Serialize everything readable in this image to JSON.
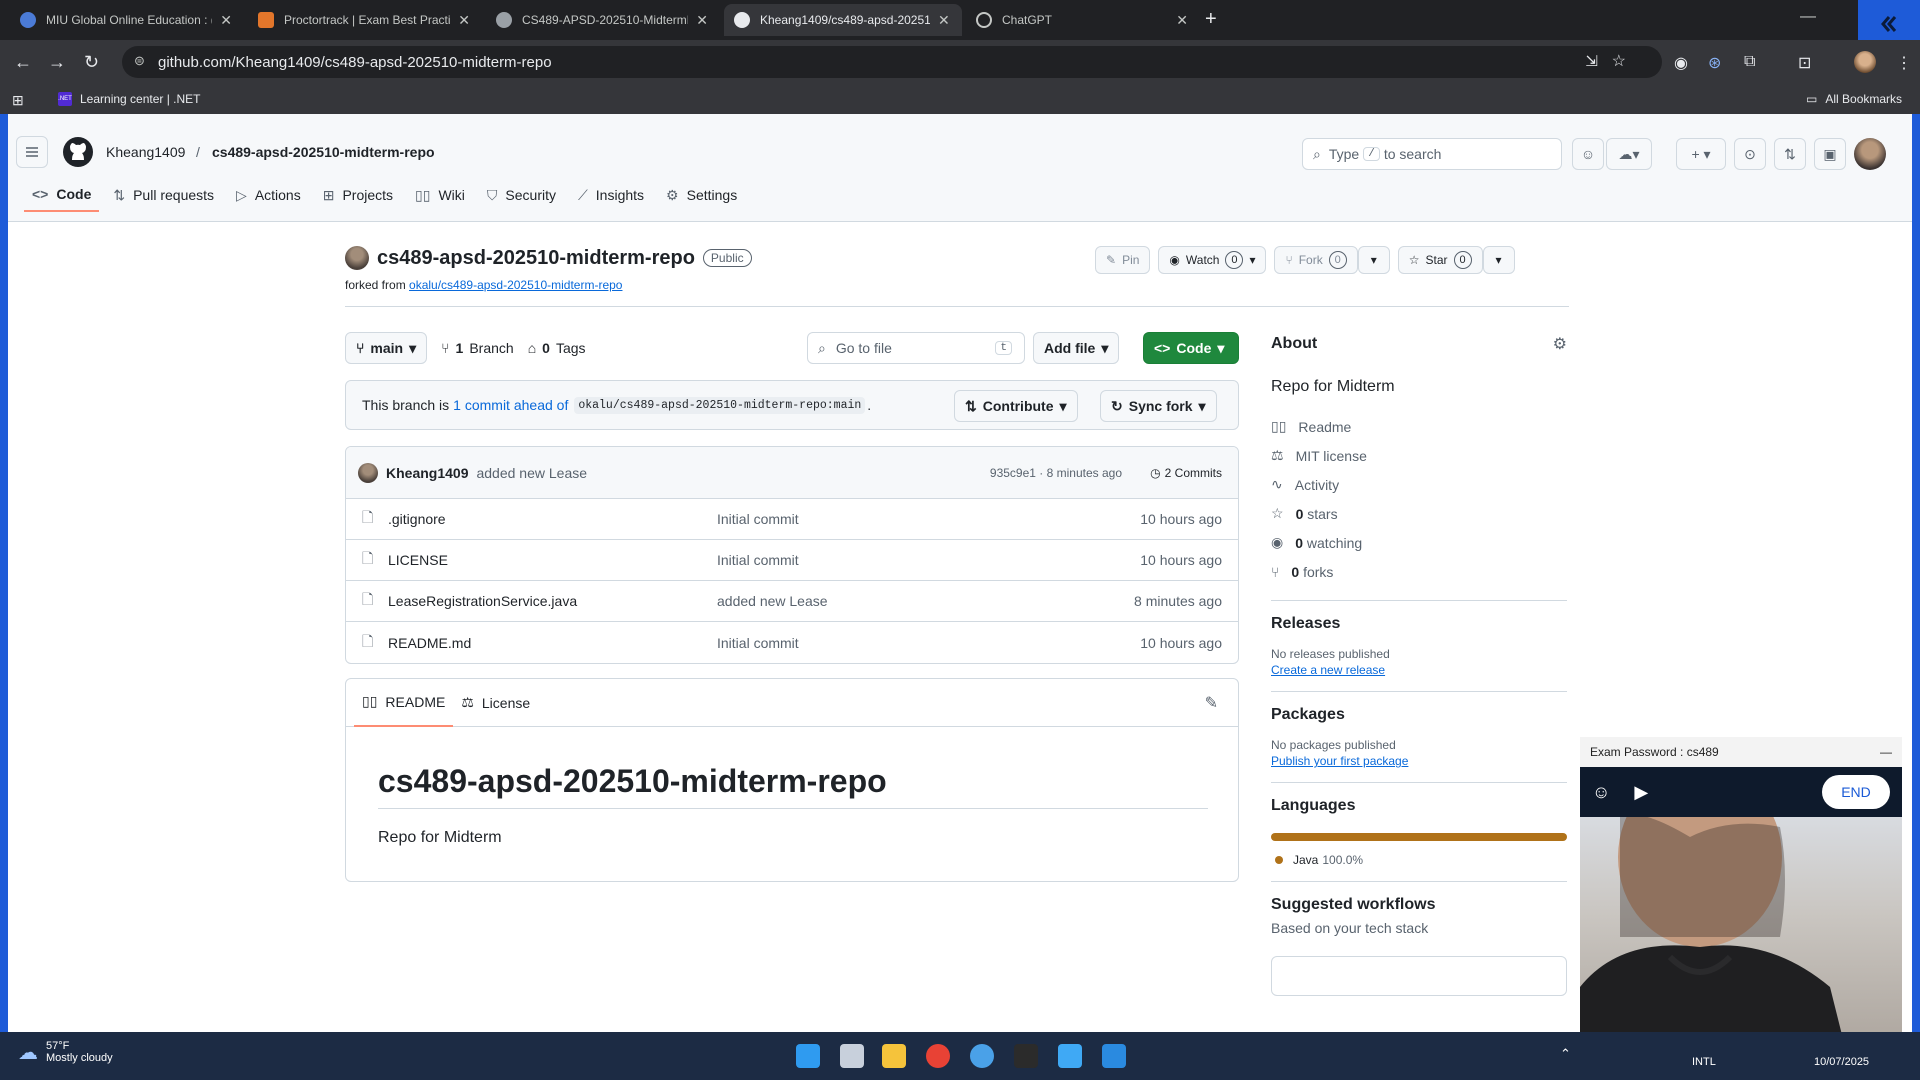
{
  "browser": {
    "tabs": [
      {
        "title": "MIU Global Online Education : (",
        "favicon_color": "#4b7bd6"
      },
      {
        "title": "Proctortrack | Exam Best Practic",
        "favicon_color": "#e2762b"
      },
      {
        "title": "CS489-APSD-202510-MidtermE",
        "favicon_color": "#9aa0a6"
      },
      {
        "title": "Kheang1409/cs489-apsd-20251(",
        "favicon_color": "#e8eaed"
      },
      {
        "title": "ChatGPT",
        "favicon_color": "#c4c7c5"
      }
    ],
    "active_tab_index": 3,
    "url": "github.com/Kheang1409/cs489-apsd-202510-midterm-repo",
    "bookmarks": {
      "item": "Learning center | .NET",
      "all": "All Bookmarks"
    }
  },
  "github": {
    "owner": "Kheang1409",
    "separator": "/",
    "repo": "cs489-apsd-202510-midterm-repo",
    "search_prefix": "Type",
    "search_key": "/",
    "search_suffix": "to search",
    "nav": [
      "Code",
      "Pull requests",
      "Actions",
      "Projects",
      "Wiki",
      "Security",
      "Insights",
      "Settings"
    ],
    "visibility": "Public",
    "forked_prefix": "forked from",
    "forked_from": "okalu/cs489-apsd-202510-midterm-repo",
    "pin": "Pin",
    "watch": "Watch",
    "watch_count": "0",
    "fork": "Fork",
    "fork_count": "0",
    "star": "Star",
    "star_count": "0",
    "branch": "main",
    "branches_count": "1",
    "branches_label": "Branch",
    "tags_count": "0",
    "tags_label": "Tags",
    "go_to_file": "Go to file",
    "go_to_file_key": "t",
    "add_file": "Add file",
    "code_btn": "Code",
    "banner": {
      "prefix": "This branch is",
      "link": "1 commit ahead of",
      "ref": "okalu/cs489-apsd-202510-midterm-repo:main",
      "suffix": ".",
      "contribute": "Contribute",
      "sync": "Sync fork"
    },
    "latest_commit": {
      "author": "Kheang1409",
      "message": "added new Lease",
      "meta": "935c9e1 · 8 minutes ago",
      "commits": "2 Commits"
    },
    "files": [
      {
        "name": ".gitignore",
        "message": "Initial commit",
        "date": "10 hours ago"
      },
      {
        "name": "LICENSE",
        "message": "Initial commit",
        "date": "10 hours ago"
      },
      {
        "name": "LeaseRegistrationService.java",
        "message": "added new Lease",
        "date": "8 minutes ago"
      },
      {
        "name": "README.md",
        "message": "Initial commit",
        "date": "10 hours ago"
      }
    ],
    "readme_tab": "README",
    "license_tab": "License",
    "readme_title": "cs489-apsd-202510-midterm-repo",
    "readme_body": "Repo for Midterm",
    "about": {
      "title": "About",
      "description": "Repo for Midterm",
      "readme": "Readme",
      "license": "MIT license",
      "activity": "Activity",
      "stars_n": "0",
      "stars": "stars",
      "watching_n": "0",
      "watching": "watching",
      "forks_n": "0",
      "forks": "forks"
    },
    "releases": {
      "title": "Releases",
      "none": "No releases published",
      "link": "Create a new release"
    },
    "packages": {
      "title": "Packages",
      "none": "No packages published",
      "link": "Publish your first package"
    },
    "languages": {
      "title": "Languages",
      "items": [
        {
          "name": "Java",
          "percent": "100.0%",
          "share": 1.0,
          "color": "#b07219"
        }
      ]
    },
    "workflows": {
      "title": "Suggested workflows",
      "subtitle": "Based on your tech stack"
    }
  },
  "proctor": {
    "header": "Exam Password : cs489",
    "minimize": "—",
    "end": "END"
  },
  "taskbar": {
    "temp": "57°F",
    "weather": "Mostly cloudy",
    "lang": "INTL",
    "date": "10/07/2025"
  }
}
